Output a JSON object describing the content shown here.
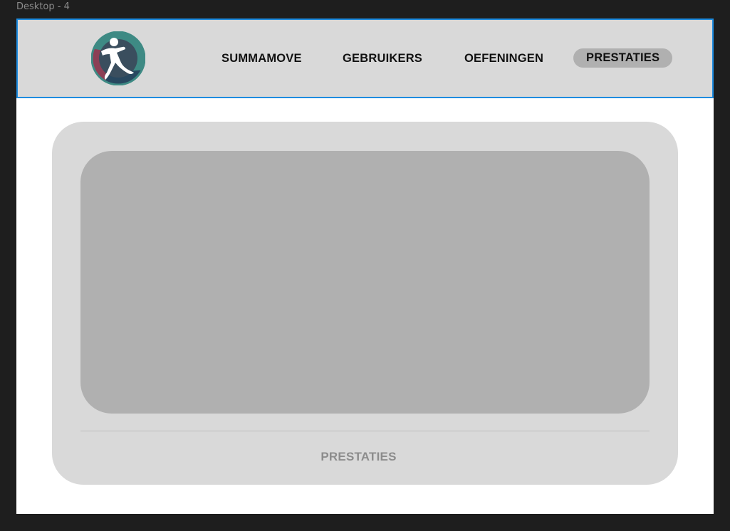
{
  "frame": {
    "label": "Desktop - 4"
  },
  "nav": {
    "items": [
      {
        "label": "SUMMAMOVE",
        "active": false
      },
      {
        "label": "GEBRUIKERS",
        "active": false
      },
      {
        "label": "OEFENINGEN",
        "active": false
      },
      {
        "label": "PRESTATIES",
        "active": true
      }
    ]
  },
  "card": {
    "caption": "PRESTATIES"
  },
  "colors": {
    "canvas_bg": "#1e1e1e",
    "artboard_bg": "#ffffff",
    "navbar_bg": "#d9d9d9",
    "selection_border": "#1e8ce0",
    "active_pill": "#b0b0b0",
    "card_bg": "#d9d9d9",
    "media_placeholder": "#b0b0b0",
    "caption_text": "#8c8c8c",
    "logo_teal": "#3e8a84",
    "logo_maroon": "#8c3f55",
    "logo_navy": "#284860"
  },
  "icons": {
    "logo": "running-figure-logo-icon"
  }
}
